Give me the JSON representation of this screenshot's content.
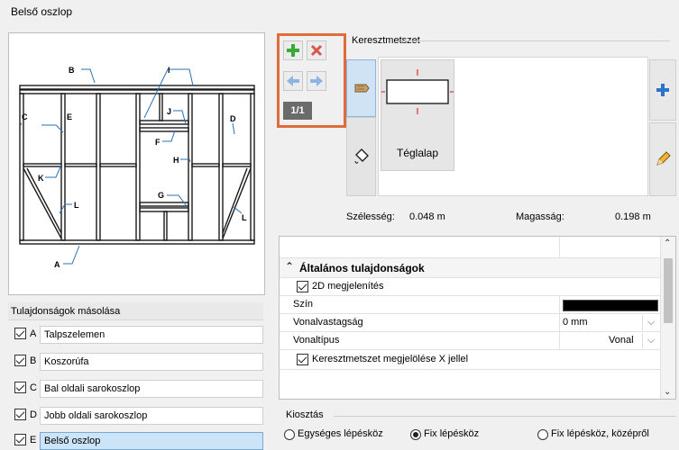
{
  "window": {
    "title": "Belső oszlop"
  },
  "diagram": {
    "labels": [
      "A",
      "B",
      "C",
      "D",
      "E",
      "F",
      "G",
      "H",
      "I",
      "J",
      "K",
      "L",
      "L"
    ]
  },
  "copy_properties": {
    "header": "Tulajdonságok másolása",
    "items": [
      {
        "letter": "A",
        "label": "Talpszelemen",
        "checked": true,
        "selected": false
      },
      {
        "letter": "B",
        "label": "Koszorúfa",
        "checked": true,
        "selected": false
      },
      {
        "letter": "C",
        "label": "Bal oldali sarokoszlop",
        "checked": true,
        "selected": false
      },
      {
        "letter": "D",
        "label": "Jobb oldali sarokoszlop",
        "checked": true,
        "selected": false
      },
      {
        "letter": "E",
        "label": "Belső oszlop",
        "checked": true,
        "selected": true
      }
    ]
  },
  "toolbar": {
    "pager": "1/1"
  },
  "cross_section": {
    "legend": "Keresztmetszet",
    "profile_name": "Téglalap",
    "width_label": "Szélesség:",
    "width_value": "0.048 m",
    "height_label": "Magasság:",
    "height_value": "0.198 m"
  },
  "properties": {
    "section_title": "Általános tulajdonságok",
    "show_2d_label": "2D megjelenítés",
    "color_label": "Szín",
    "color_value": "#000000",
    "line_width_label": "Vonalvastagság",
    "line_width_value": "0 mm",
    "line_type_label": "Vonaltípus",
    "line_type_value": "Vonal",
    "x_mark_label": "Keresztmetszet megjelölése X jellel"
  },
  "distribution": {
    "legend": "Kiosztás",
    "options": [
      {
        "label": "Egységes lépésköz",
        "selected": false
      },
      {
        "label": "Fix lépésköz",
        "selected": true
      },
      {
        "label": "Fix lépésköz, középről",
        "selected": false
      }
    ]
  },
  "colors": {
    "accent_orange": "#e06b3b",
    "plus_green": "#3aa935",
    "delete_red": "#d9534f",
    "nav_blue": "#4a90d9",
    "selected_row": "#cce4f7"
  }
}
